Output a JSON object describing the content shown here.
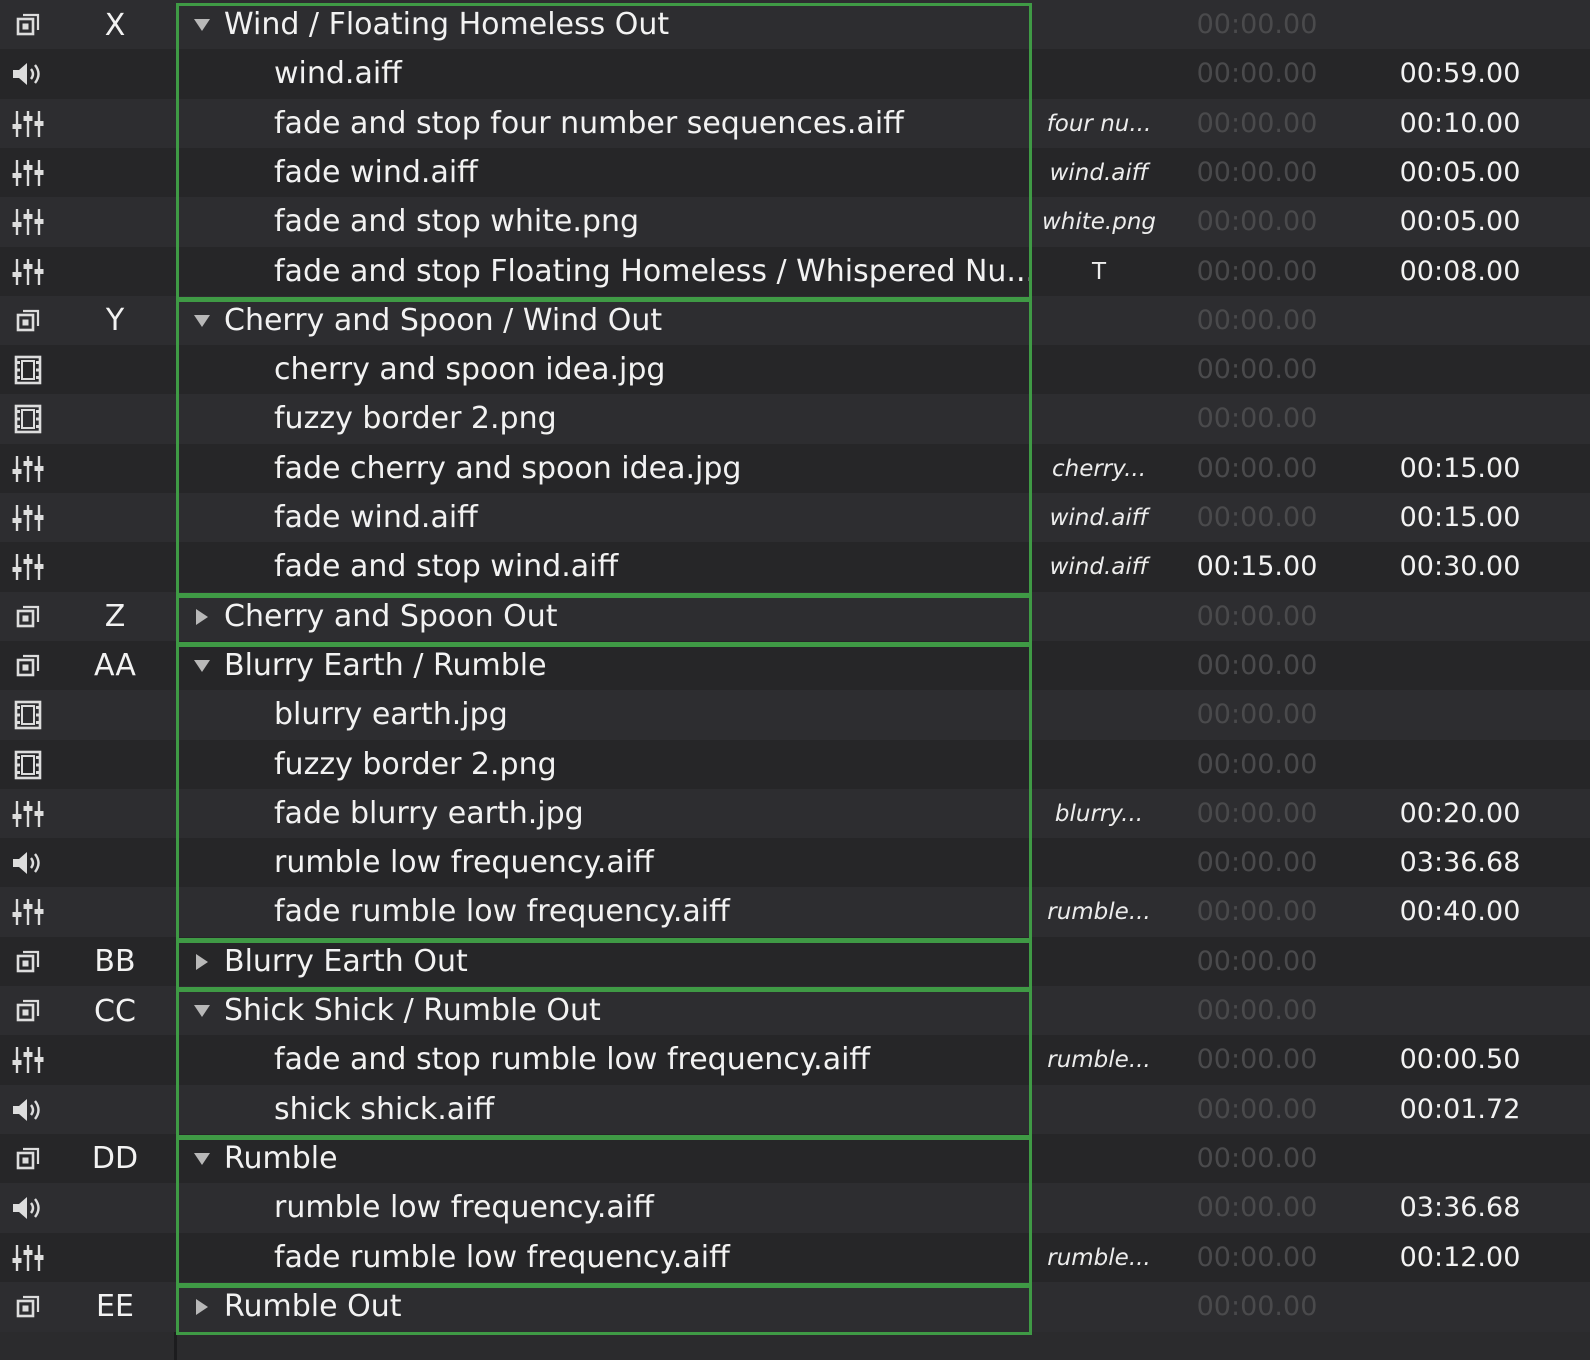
{
  "colors": {
    "group_border": "#3f9a45",
    "dim_time": "#4a4a4c",
    "text": "#f2f2f2"
  },
  "cues": [
    {
      "type": "group",
      "number": "X",
      "name": "Wind / Floating Homeless Out",
      "expanded": true,
      "target": "",
      "prewait": "00:00.00",
      "prewait_active": false,
      "action": "",
      "icon": "group-icon",
      "members": 5
    },
    {
      "type": "audio",
      "number": "",
      "name": "wind.aiff",
      "target": "",
      "prewait": "00:00.00",
      "prewait_active": false,
      "action": "00:59.00",
      "icon": "speaker-icon"
    },
    {
      "type": "fade",
      "number": "",
      "name": "fade and stop four number sequences.aiff",
      "target": "four nu...",
      "prewait": "00:00.00",
      "prewait_active": false,
      "action": "00:10.00",
      "icon": "fader-icon"
    },
    {
      "type": "fade",
      "number": "",
      "name": "fade wind.aiff",
      "target": "wind.aiff",
      "prewait": "00:00.00",
      "prewait_active": false,
      "action": "00:05.00",
      "icon": "fader-icon"
    },
    {
      "type": "fade",
      "number": "",
      "name": "fade and stop white.png",
      "target": "white.png",
      "prewait": "00:00.00",
      "prewait_active": false,
      "action": "00:05.00",
      "icon": "fader-icon"
    },
    {
      "type": "fade",
      "number": "",
      "name": "fade and stop Floating Homeless / Whispered Nu...",
      "target": "T",
      "target_plain": true,
      "prewait": "00:00.00",
      "prewait_active": false,
      "action": "00:08.00",
      "icon": "fader-icon"
    },
    {
      "type": "group",
      "number": "Y",
      "name": "Cherry and Spoon / Wind Out",
      "expanded": true,
      "target": "",
      "prewait": "00:00.00",
      "prewait_active": false,
      "action": "",
      "icon": "group-icon",
      "members": 5
    },
    {
      "type": "video",
      "number": "",
      "name": "cherry and spoon idea.jpg",
      "target": "",
      "prewait": "00:00.00",
      "prewait_active": false,
      "action": "",
      "icon": "film-icon"
    },
    {
      "type": "video",
      "number": "",
      "name": "fuzzy border 2.png",
      "target": "",
      "prewait": "00:00.00",
      "prewait_active": false,
      "action": "",
      "icon": "film-icon"
    },
    {
      "type": "fade",
      "number": "",
      "name": "fade cherry and spoon idea.jpg",
      "target": "cherry...",
      "prewait": "00:00.00",
      "prewait_active": false,
      "action": "00:15.00",
      "icon": "fader-icon"
    },
    {
      "type": "fade",
      "number": "",
      "name": "fade wind.aiff",
      "target": "wind.aiff",
      "prewait": "00:00.00",
      "prewait_active": false,
      "action": "00:15.00",
      "icon": "fader-icon"
    },
    {
      "type": "fade",
      "number": "",
      "name": "fade and stop wind.aiff",
      "target": "wind.aiff",
      "prewait": "00:15.00",
      "prewait_active": true,
      "action": "00:30.00",
      "icon": "fader-icon"
    },
    {
      "type": "group",
      "number": "Z",
      "name": "Cherry and Spoon Out",
      "expanded": false,
      "target": "",
      "prewait": "00:00.00",
      "prewait_active": false,
      "action": "",
      "icon": "group-icon",
      "members": 0
    },
    {
      "type": "group",
      "number": "AA",
      "name": "Blurry Earth / Rumble",
      "expanded": true,
      "target": "",
      "prewait": "00:00.00",
      "prewait_active": false,
      "action": "",
      "icon": "group-icon",
      "members": 5
    },
    {
      "type": "video",
      "number": "",
      "name": "blurry earth.jpg",
      "target": "",
      "prewait": "00:00.00",
      "prewait_active": false,
      "action": "",
      "icon": "film-icon"
    },
    {
      "type": "video",
      "number": "",
      "name": "fuzzy border 2.png",
      "target": "",
      "prewait": "00:00.00",
      "prewait_active": false,
      "action": "",
      "icon": "film-icon"
    },
    {
      "type": "fade",
      "number": "",
      "name": "fade blurry earth.jpg",
      "target": "blurry...",
      "prewait": "00:00.00",
      "prewait_active": false,
      "action": "00:20.00",
      "icon": "fader-icon"
    },
    {
      "type": "audio",
      "number": "",
      "name": "rumble low frequency.aiff",
      "target": "",
      "prewait": "00:00.00",
      "prewait_active": false,
      "action": "03:36.68",
      "icon": "speaker-icon"
    },
    {
      "type": "fade",
      "number": "",
      "name": "fade rumble low frequency.aiff",
      "target": "rumble...",
      "prewait": "00:00.00",
      "prewait_active": false,
      "action": "00:40.00",
      "icon": "fader-icon"
    },
    {
      "type": "group",
      "number": "BB",
      "name": "Blurry Earth Out",
      "expanded": false,
      "target": "",
      "prewait": "00:00.00",
      "prewait_active": false,
      "action": "",
      "icon": "group-icon",
      "members": 0
    },
    {
      "type": "group",
      "number": "CC",
      "name": "Shick Shick / Rumble Out",
      "expanded": true,
      "target": "",
      "prewait": "00:00.00",
      "prewait_active": false,
      "action": "",
      "icon": "group-icon",
      "members": 2
    },
    {
      "type": "fade",
      "number": "",
      "name": "fade and stop rumble low frequency.aiff",
      "target": "rumble...",
      "prewait": "00:00.00",
      "prewait_active": false,
      "action": "00:00.50",
      "icon": "fader-icon"
    },
    {
      "type": "audio",
      "number": "",
      "name": "shick shick.aiff",
      "target": "",
      "prewait": "00:00.00",
      "prewait_active": false,
      "action": "00:01.72",
      "icon": "speaker-icon"
    },
    {
      "type": "group",
      "number": "DD",
      "name": "Rumble",
      "expanded": true,
      "target": "",
      "prewait": "00:00.00",
      "prewait_active": false,
      "action": "",
      "icon": "group-icon",
      "members": 2
    },
    {
      "type": "audio",
      "number": "",
      "name": "rumble low frequency.aiff",
      "target": "",
      "prewait": "00:00.00",
      "prewait_active": false,
      "action": "03:36.68",
      "icon": "speaker-icon"
    },
    {
      "type": "fade",
      "number": "",
      "name": "fade rumble low frequency.aiff",
      "target": "rumble...",
      "prewait": "00:00.00",
      "prewait_active": false,
      "action": "00:12.00",
      "icon": "fader-icon"
    },
    {
      "type": "group",
      "number": "EE",
      "name": "Rumble Out",
      "expanded": false,
      "target": "",
      "prewait": "00:00.00",
      "prewait_active": false,
      "action": "",
      "icon": "group-icon",
      "members": 0
    }
  ]
}
